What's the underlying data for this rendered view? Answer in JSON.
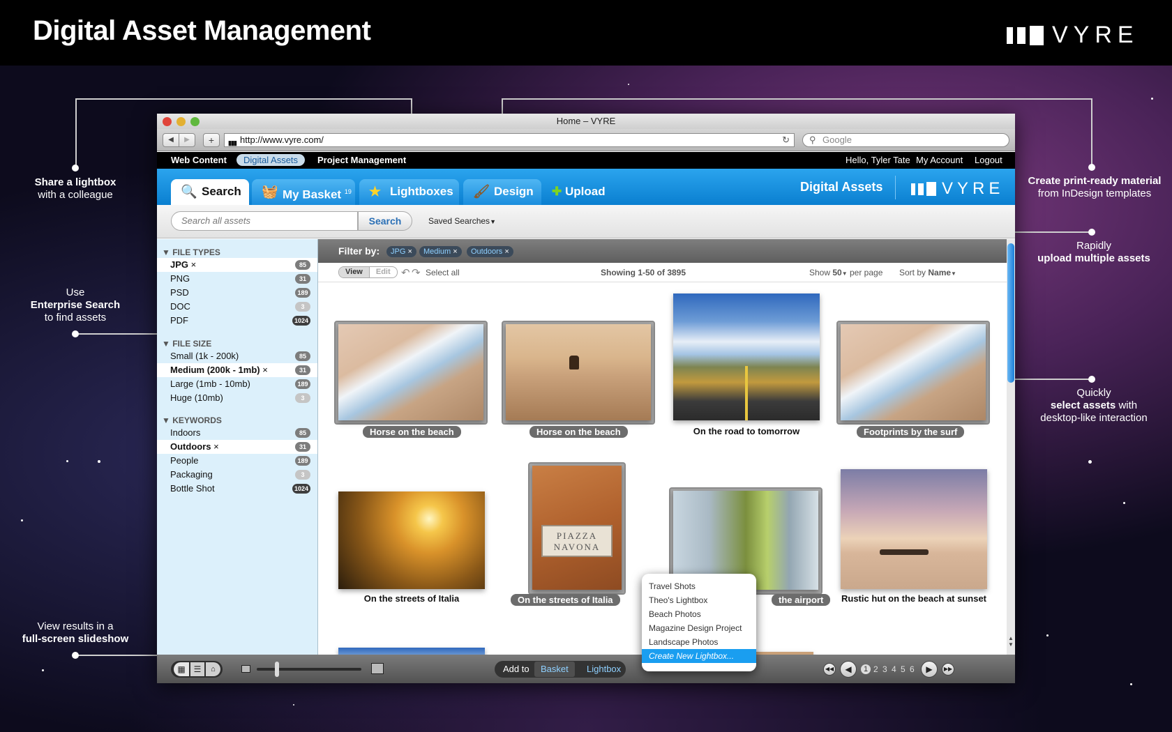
{
  "header": {
    "title": "Digital Asset Management",
    "logo": "VYRE"
  },
  "callouts": {
    "share": {
      "bold": "Share a lightbox",
      "rest": "with a colleague"
    },
    "enterprise": {
      "pre": "Use",
      "bold": "Enterprise Search",
      "rest": "to find assets"
    },
    "slideshow": {
      "pre": "View results in a",
      "bold": "full-screen slideshow"
    },
    "print": {
      "bold": "Create print-ready material",
      "rest": "from InDesign templates"
    },
    "upload": {
      "pre": "Rapidly",
      "bold": "upload multiple assets"
    },
    "select": {
      "pre": "Quickly",
      "bold": "select assets",
      "mid": "with",
      "rest": "desktop-like interaction"
    }
  },
  "browser": {
    "title": "Home – VYRE",
    "url": "http://www.vyre.com/",
    "search_placeholder": "Google"
  },
  "topnav": {
    "web_content": "Web Content",
    "digital_assets": "Digital Assets",
    "project_management": "Project Management",
    "greeting": "Hello, Tyler Tate",
    "my_account": "My Account",
    "logout": "Logout"
  },
  "tabs": {
    "search": "Search",
    "basket": "My Basket",
    "basket_count": "19",
    "lightboxes": "Lightboxes",
    "design": "Design",
    "upload": "Upload",
    "section_title": "Digital Assets",
    "logo": "VYRE"
  },
  "search": {
    "placeholder": "Search all assets",
    "button": "Search",
    "saved": "Saved Searches"
  },
  "sidebar": {
    "file_types": {
      "title": "FILE TYPES",
      "items": [
        {
          "label": "JPG",
          "count": "85"
        },
        {
          "label": "PNG",
          "count": "31"
        },
        {
          "label": "PSD",
          "count": "189"
        },
        {
          "label": "DOC",
          "count": "3"
        },
        {
          "label": "PDF",
          "count": "1024"
        }
      ]
    },
    "file_size": {
      "title": "FILE SIZE",
      "items": [
        {
          "label": "Small (1k - 200k)",
          "count": "85"
        },
        {
          "label": "Medium (200k - 1mb)",
          "count": "31"
        },
        {
          "label": "Large (1mb - 10mb)",
          "count": "189"
        },
        {
          "label": "Huge (10mb)",
          "count": "3"
        }
      ]
    },
    "keywords": {
      "title": "KEYWORDS",
      "items": [
        {
          "label": "Indoors",
          "count": "85"
        },
        {
          "label": "Outdoors",
          "count": "31"
        },
        {
          "label": "People",
          "count": "189"
        },
        {
          "label": "Packaging",
          "count": "3"
        },
        {
          "label": "Bottle Shot",
          "count": "1024"
        }
      ]
    }
  },
  "filter": {
    "label": "Filter by:",
    "chips": [
      "JPG",
      "Medium",
      "Outdoors"
    ],
    "remove": "×"
  },
  "viewbar": {
    "view": "View",
    "edit": "Edit",
    "select_all": "Select all",
    "showing": "Showing 1-50 of 3895",
    "show": "Show",
    "per_page_value": "50",
    "per_page": "per page",
    "sort_by": "Sort by",
    "sort_value": "Name"
  },
  "assets": [
    "Horse on the beach",
    "Horse on the beach",
    "On the road to tomorrow",
    "Footprints by the surf",
    "On the streets of Italia",
    "On the streets of Italia",
    "the airport",
    "Rustic hut on the beach at sunset"
  ],
  "popup": {
    "items": [
      "Travel Shots",
      "Theo's Lightbox",
      "Beach Photos",
      "Magazine Design Project",
      "Landscape Photos",
      "Create New Lightbox..."
    ]
  },
  "bottombar": {
    "add_to": "Add to",
    "basket": "Basket",
    "lightbox": "Lightbox",
    "pages": [
      "1",
      "2",
      "3",
      "4",
      "5",
      "6"
    ]
  },
  "sign_text": {
    "l1": "PIAZZA",
    "l2": "NAVONA"
  },
  "colors": {
    "accent": "#1a8ddd",
    "sidebar": "#dcf0fb",
    "popup_highlight": "#1a9ef0"
  }
}
